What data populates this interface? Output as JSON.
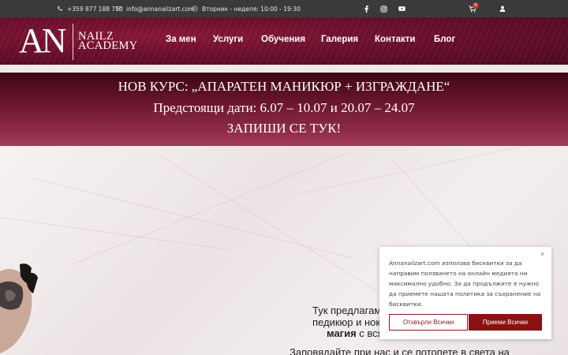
{
  "topbar": {
    "phone": "+359 877 188 750",
    "email": "info@annanailzart.com",
    "hours": "Вторник - неделя: 10:00 - 19:30",
    "cart_count": "0",
    "icons": [
      "phone-icon",
      "envelope-icon",
      "clock-icon",
      "facebook-icon",
      "instagram-icon",
      "youtube-icon",
      "cart-icon",
      "user-icon"
    ]
  },
  "header": {
    "logo_mark": "AN",
    "logo_line1": "NAILZ",
    "logo_line2": "ACADEMY",
    "nav": [
      "За мен",
      "Услуги",
      "Обучения",
      "Галерия",
      "Контакти",
      "Блог"
    ]
  },
  "banner": {
    "line1": "НОВ КУРС: „АПАРАТЕН МАНИКЮР + ИЗГРАЖДАНЕ“",
    "line2": "Предстоящи дати: 6.07 – 10.07 и 20.07 – 24.07",
    "line3": "ЗАПИШИ СЕ ТУК!"
  },
  "hero": {
    "line1": "Тук предлагам",
    "line2": "педикюр и нок",
    "line3_bold": "магия",
    "line3_rest": " с вся",
    "line4": "Заповядайте при нас и се потопете в света на"
  },
  "cookie": {
    "text": "Annanailzart.com използва бисквитки за да направим ползването на онлайн медиятa ни максимално удобно. За да продължите е нужно да приемете нашата политика за съхранение на бисквитки.",
    "reject_label": "Отхвърли Всички",
    "accept_label": "Приеми Всички",
    "close_label": "×"
  },
  "colors": {
    "brand": "#6b0f2c",
    "topbar": "#3a3a3a",
    "accept": "#8b1212"
  }
}
